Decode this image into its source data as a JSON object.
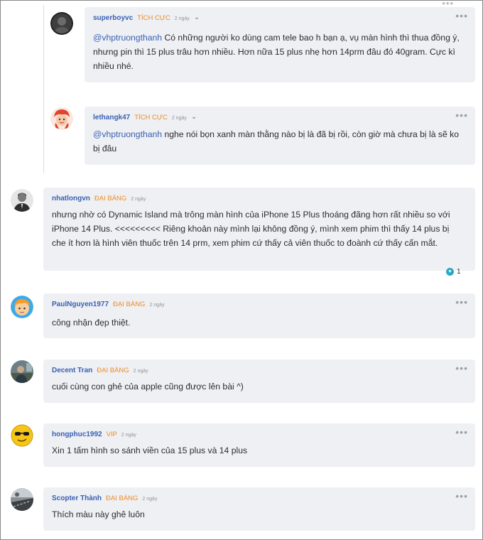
{
  "comments": [
    {
      "username": "superboyvc",
      "rank": "TÍCH CỰC",
      "time": "2 ngày",
      "mention": "@vhptruongthanh",
      "body": " Có những người ko dùng cam tele bao h bạn ạ, vụ màn hình thì thua đồng ý, nhưng pin thì 15 plus trâu hơn nhiều. Hơn nữa 15 plus nhẹ hơn 14prm đâu đó 40gram. Cực kì nhiều nhé.",
      "avatar_icon": "avatar-dark-profile-icon"
    },
    {
      "username": "lethangk47",
      "rank": "TÍCH CỰC",
      "time": "2 ngày",
      "mention": "@vhptruongthanh",
      "body": " nghe nói bọn xanh màn thằng nào bị là đã bị rồi, còn giờ mà chưa bị là sẽ ko bị đâu",
      "avatar_icon": "avatar-red-cartoon-icon"
    },
    {
      "username": "nhatlongvn",
      "rank": "ĐẠI BÀNG",
      "time": "2 ngày",
      "body": "nhưng nhờ có Dynamic Island mà trông màn hình của iPhone 15 Plus thoáng đãng hơn rất nhiều so với iPhone 14 Plus. <<<<<<<<< Riêng khoản này mình lại không đồng ý, mình xem phim thì thấy 14 plus bị che ít hơn là hình viên thuốc trên 14 prm, xem phim cứ thấy cả viên thuốc to đoành cứ thấy cấn mắt.",
      "reaction_count": "1",
      "avatar_icon": "avatar-man-portrait-icon"
    },
    {
      "username": "PaulNguyen1977",
      "rank": "ĐẠI BÀNG",
      "time": "2 ngày",
      "body": "công nhận đẹp thiệt.",
      "avatar_icon": "avatar-cartoon-boy-icon"
    },
    {
      "username": "Decent Tran",
      "rank": "ĐẠI BÀNG",
      "time": "2 ngày",
      "body": "cuối cùng con ghẻ của apple cũng được lên bài ^)",
      "avatar_icon": "avatar-photo-icon"
    },
    {
      "username": "hongphuc1992",
      "rank": "VIP",
      "time": "2 ngày",
      "body": "Xin 1 tấm hình so sánh viền của 15 plus và 14 plus",
      "avatar_icon": "avatar-sunglasses-emoji-icon"
    },
    {
      "username": "Scopter Thành",
      "rank": "ĐẠI BÀNG",
      "time": "2 ngày",
      "body": "Thích màu này ghê luôn",
      "avatar_icon": "avatar-road-photo-icon"
    }
  ],
  "ui": {
    "more_glyph": "•••",
    "chevron_glyph": "⌄",
    "heart_glyph": "♥"
  },
  "colors": {
    "username": "#3a5fb4",
    "rank": "#ee8a26",
    "bubble": "#eef0f3",
    "reaction": "#27a9c4"
  }
}
